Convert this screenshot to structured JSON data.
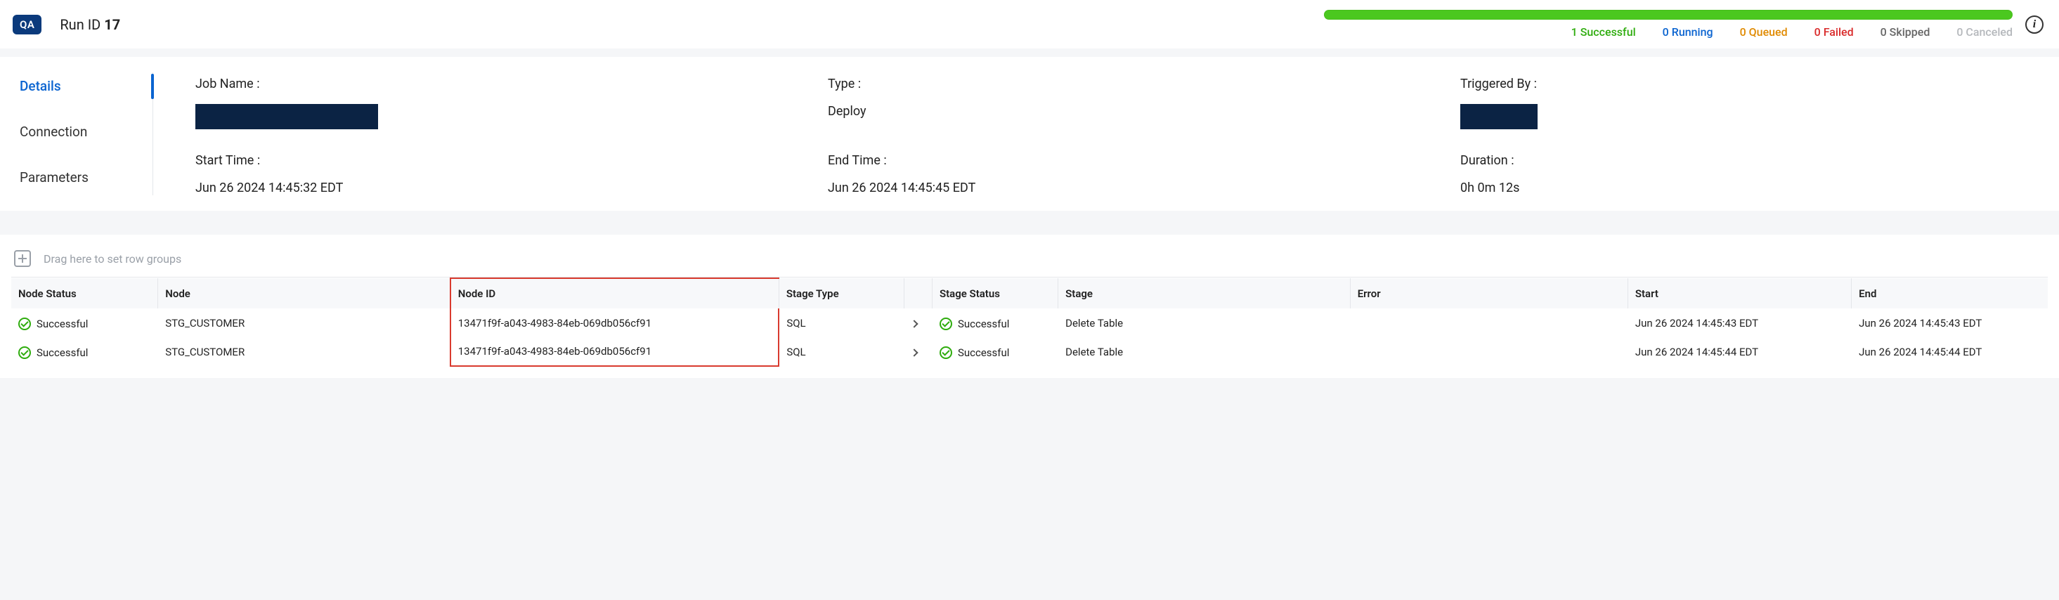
{
  "env_badge": "QA",
  "run_id_label": "Run ID",
  "run_id_value": "17",
  "status_counts": {
    "successful": "1 Successful",
    "running": "0 Running",
    "queued": "0 Queued",
    "failed": "0 Failed",
    "skipped": "0 Skipped",
    "canceled": "0 Canceled"
  },
  "sidebar": {
    "details": "Details",
    "connection": "Connection",
    "parameters": "Parameters"
  },
  "fields": {
    "job_name_label": "Job Name :",
    "type_label": "Type :",
    "triggered_by_label": "Triggered By :",
    "start_time_label": "Start Time :",
    "end_time_label": "End Time :",
    "duration_label": "Duration :",
    "type_value": "Deploy",
    "start_time_value": "Jun 26 2024 14:45:32 EDT",
    "end_time_value": "Jun 26 2024 14:45:45 EDT",
    "duration_value": "0h 0m 12s"
  },
  "group_hint": "Drag here to set row groups",
  "columns": {
    "node_status": "Node Status",
    "node": "Node",
    "node_id": "Node ID",
    "stage_type": "Stage Type",
    "stage_status": "Stage Status",
    "stage": "Stage",
    "error": "Error",
    "start": "Start",
    "end": "End"
  },
  "rows": [
    {
      "node_status": "Successful",
      "node": "STG_CUSTOMER",
      "node_id": "13471f9f-a043-4983-84eb-069db056cf91",
      "stage_type": "SQL",
      "stage_status": "Successful",
      "stage": "Delete Table",
      "error": "",
      "start": "Jun 26 2024 14:45:43 EDT",
      "end": "Jun 26 2024 14:45:43 EDT"
    },
    {
      "node_status": "Successful",
      "node": "STG_CUSTOMER",
      "node_id": "13471f9f-a043-4983-84eb-069db056cf91",
      "stage_type": "SQL",
      "stage_status": "Successful",
      "stage": "Delete Table",
      "error": "",
      "start": "Jun 26 2024 14:45:44 EDT",
      "end": "Jun 26 2024 14:45:44 EDT"
    }
  ]
}
